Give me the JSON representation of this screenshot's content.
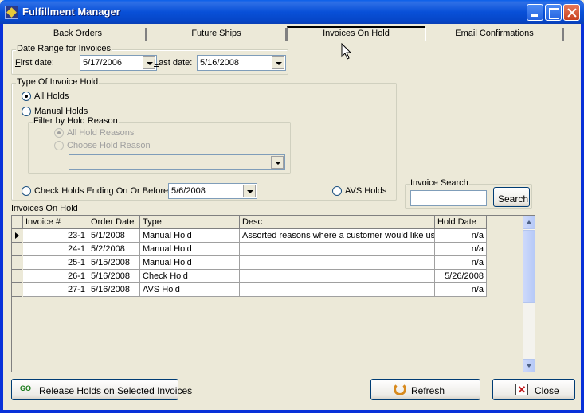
{
  "window": {
    "title": "Fulfillment Manager"
  },
  "tabs": [
    {
      "label": "Back Orders"
    },
    {
      "label": "Future Ships"
    },
    {
      "label": "Invoices On Hold"
    },
    {
      "label": "Email Confirmations"
    }
  ],
  "date_range": {
    "legend": "Date Range for Invoices",
    "first_label_ul": "F",
    "first_label_rest": "irst date:",
    "first_value": "5/17/2006",
    "last_label_ul": "L",
    "last_label_rest": "ast date:",
    "last_value": "5/16/2008"
  },
  "hold_type": {
    "legend": "Type Of Invoice Hold",
    "all_holds": "All Holds",
    "manual_holds": "Manual Holds",
    "filter_legend": "Filter by Hold Reason",
    "all_reasons": "All Hold Reasons",
    "choose_reason": "Choose Hold Reason",
    "reason_value": "",
    "check_holds": "Check Holds Ending On Or Before:",
    "check_date": "5/6/2008",
    "avs_holds": "AVS Holds"
  },
  "invoice_search": {
    "legend": "Invoice Search",
    "value": "",
    "button": "Search"
  },
  "grid": {
    "title": "Invoices On Hold",
    "columns": [
      "Invoice #",
      "Order Date",
      "Type",
      "Desc",
      "Hold Date"
    ],
    "rows": [
      [
        "23-1",
        "5/1/2008",
        "Manual Hold",
        "Assorted reasons where a customer would like us to",
        "n/a"
      ],
      [
        "24-1",
        "5/2/2008",
        "Manual Hold",
        "",
        "n/a"
      ],
      [
        "25-1",
        "5/15/2008",
        "Manual Hold",
        "",
        "n/a"
      ],
      [
        "26-1",
        "5/16/2008",
        "Check Hold",
        "",
        "5/26/2008"
      ],
      [
        "27-1",
        "5/16/2008",
        "AVS Hold",
        "",
        "n/a"
      ]
    ]
  },
  "buttons": {
    "release_ul": "R",
    "release_rest": "elease Holds on Selected Invoices",
    "refresh_ul": "R",
    "refresh_rest": "efresh",
    "close_ul": "C",
    "close_rest": "lose"
  }
}
